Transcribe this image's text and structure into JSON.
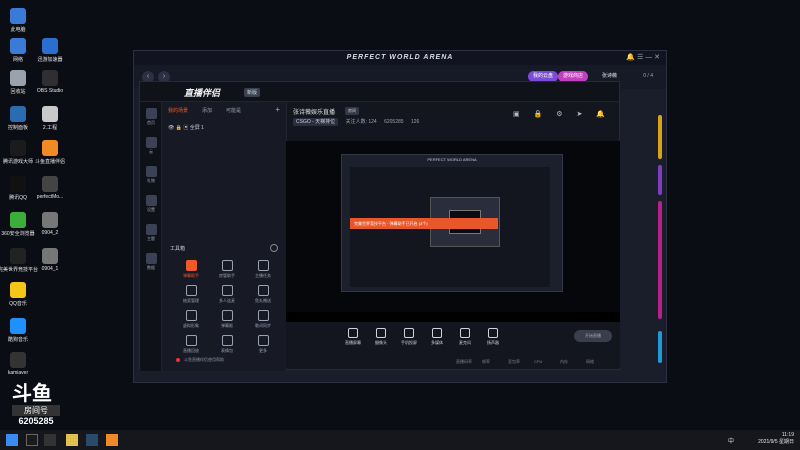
{
  "desktop": {
    "icons": [
      {
        "label": "此电脑",
        "color": "#3a7bd5"
      },
      {
        "label": "网络",
        "color": "#3a7bd5"
      },
      {
        "label": "迅游加速器",
        "color": "#2a6fd0"
      },
      {
        "label": "回收站",
        "color": "#9aa3ad"
      },
      {
        "label": "OBS Studio",
        "color": "#302e31"
      },
      {
        "label": "控制面板",
        "color": "#2b6cb0"
      },
      {
        "label": "2.工程",
        "color": "#c9c9c9"
      },
      {
        "label": "腾讯游戏大师",
        "color": "#1b1b1b"
      },
      {
        "label": "斗鱼直播伴侣",
        "color": "#f08a24"
      },
      {
        "label": "腾讯QQ",
        "color": "#111"
      },
      {
        "label": "perfectMo...",
        "color": "#444"
      },
      {
        "label": "360安全浏览器",
        "color": "#3cae3c"
      },
      {
        "label": "0904_2",
        "color": "#777"
      },
      {
        "label": "完美世界竞技平台",
        "color": "#222"
      },
      {
        "label": "0904_1",
        "color": "#777"
      },
      {
        "label": "QQ音乐",
        "color": "#f5c518"
      },
      {
        "label": "酷狗音乐",
        "color": "#1e90ff"
      },
      {
        "label": "kamiaver",
        "color": "#333"
      }
    ]
  },
  "launcher": {
    "title": "PERFECT WORLD ARENA",
    "pill_left": "我的云盘",
    "pill_right": "游戏商店",
    "user": "张诗薇",
    "counter": "0 / 4",
    "side_strips": [
      "#d9a21b",
      "#7e3fbf",
      "#b8208a",
      "#1e9bd7"
    ]
  },
  "app": {
    "logo": "直播伴侣",
    "version": "新版",
    "leftnav": [
      "首页",
      "云",
      "礼物",
      "设置",
      "主题",
      "数据"
    ],
    "scene_tabs": [
      "我的场景",
      "添加",
      "可能是"
    ],
    "scene_item": "全屏 1",
    "tools_title": "工具箱",
    "tools": [
      {
        "label": "弹幕助手",
        "hot": true
      },
      {
        "label": "房管助手",
        "hot": false
      },
      {
        "label": "主播任务",
        "hot": false
      },
      {
        "label": "抽奖管理",
        "hot": false
      },
      {
        "label": "多人连麦",
        "hot": false
      },
      {
        "label": "鱼丸赠送",
        "hot": false
      },
      {
        "label": "虚拟形象",
        "hot": false
      },
      {
        "label": "弹幕姬",
        "hot": false
      },
      {
        "label": "歌词同步",
        "hot": false
      },
      {
        "label": "直播回放",
        "hot": false
      },
      {
        "label": "表情包",
        "hot": false
      },
      {
        "label": "更多",
        "hot": false
      }
    ],
    "notice": "斗鱼直播伴侣使用帮助",
    "room_title": "张诗薇娱乐直播",
    "room_tag": "房间",
    "category": "CSGO - 天梯排位",
    "fans": "关注人数: 124",
    "room_id": "6205285",
    "viewers": "126",
    "overlay_text": "完美世界竞技平台 · 弹幕助手已开启 (3个)",
    "controls": [
      "直播屏幕",
      "摄像头",
      "手机投屏",
      "多媒体",
      "麦克风",
      "扬声器"
    ],
    "start_label": "开始直播",
    "status": [
      "直播码率",
      "帧率",
      "丢包率",
      "CPU",
      "内存",
      "网络"
    ]
  },
  "douyu": {
    "logo": "斗鱼",
    "sub": "房间号",
    "room": "6205285"
  },
  "taskbar": {
    "time": "11:19",
    "date": "2021/9/5 星期日",
    "lang": "中"
  }
}
